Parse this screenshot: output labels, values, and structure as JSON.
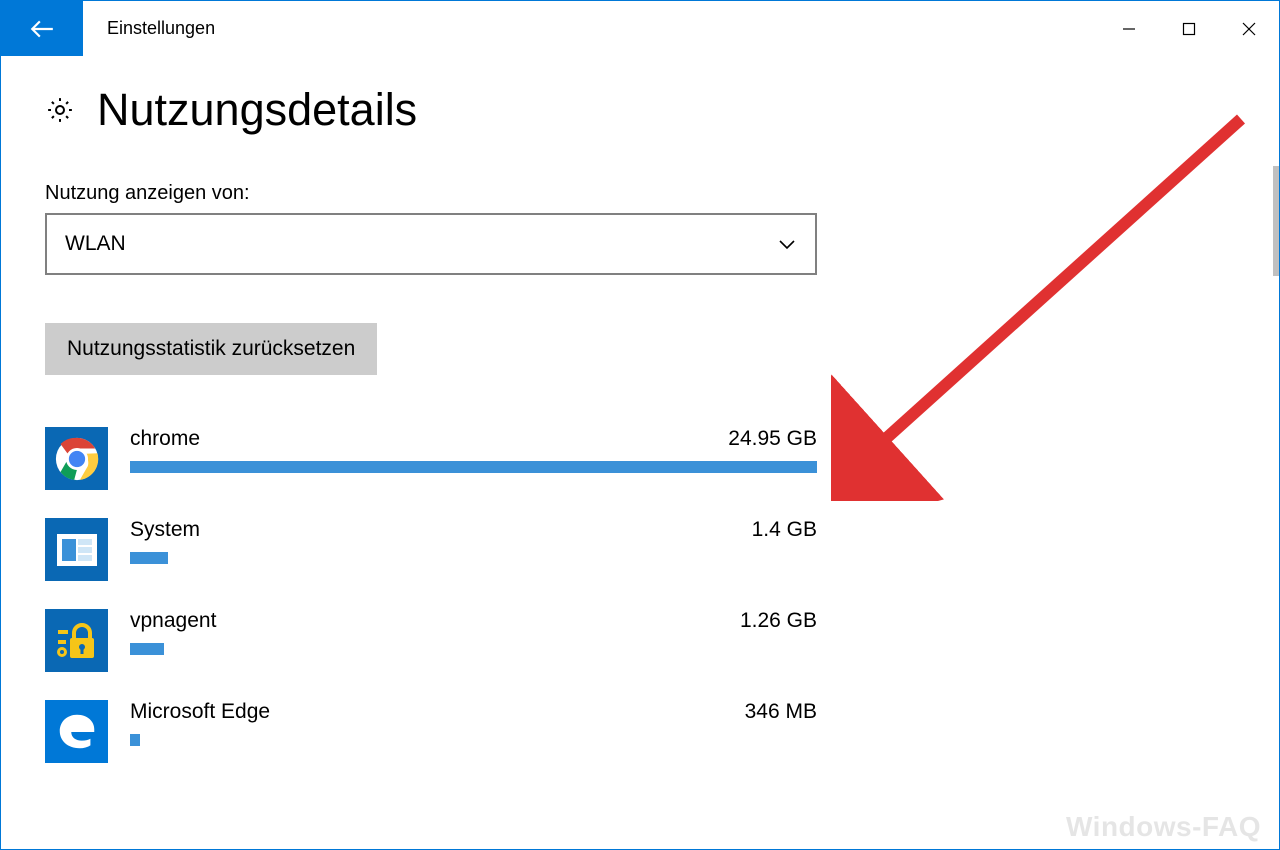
{
  "window": {
    "title": "Einstellungen"
  },
  "page": {
    "title": "Nutzungsdetails",
    "filter_label": "Nutzung anzeigen von:",
    "filter_value": "WLAN",
    "reset_button": "Nutzungsstatistik zurücksetzen"
  },
  "apps": [
    {
      "name": "chrome",
      "usage": "24.95 GB",
      "bar_pct": 100,
      "icon": "chrome"
    },
    {
      "name": "System",
      "usage": "1.4 GB",
      "bar_pct": 5.6,
      "icon": "system"
    },
    {
      "name": "vpnagent",
      "usage": "1.26 GB",
      "bar_pct": 5.0,
      "icon": "vpn"
    },
    {
      "name": "Microsoft Edge",
      "usage": "346 MB",
      "bar_pct": 1.4,
      "icon": "edge"
    }
  ],
  "watermark": "Windows-FAQ",
  "colors": {
    "accent": "#0078d7",
    "bar": "#3b91d8"
  }
}
